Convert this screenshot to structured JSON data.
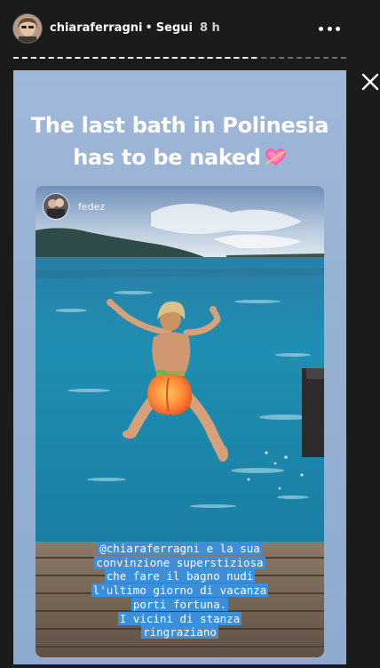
{
  "header": {
    "username": "chiaraferragni",
    "separator": "•",
    "follow_label": "Segui",
    "timestamp": "8 h"
  },
  "story": {
    "title_line1": "The last bath in Polinesia",
    "title_line2": "has to be naked",
    "title_emoji_icon": "heart-with-arrow-icon"
  },
  "post": {
    "author": "fedez",
    "caption_lines": [
      "@chiaraferragni e la sua",
      "convinzione superstiziosa",
      "che fare il bagno nudi",
      "l'ultimo giorno di vacanza",
      "porti fortuna.",
      "I vicini di stanza",
      "ringraziano"
    ],
    "caption_highlight_color": "#3f8fd8"
  },
  "progress": {
    "fraction": 0.73
  },
  "colors": {
    "background": "#1b1b1b",
    "story_background": "#97b1d4",
    "sea": "#1f8fb0"
  }
}
